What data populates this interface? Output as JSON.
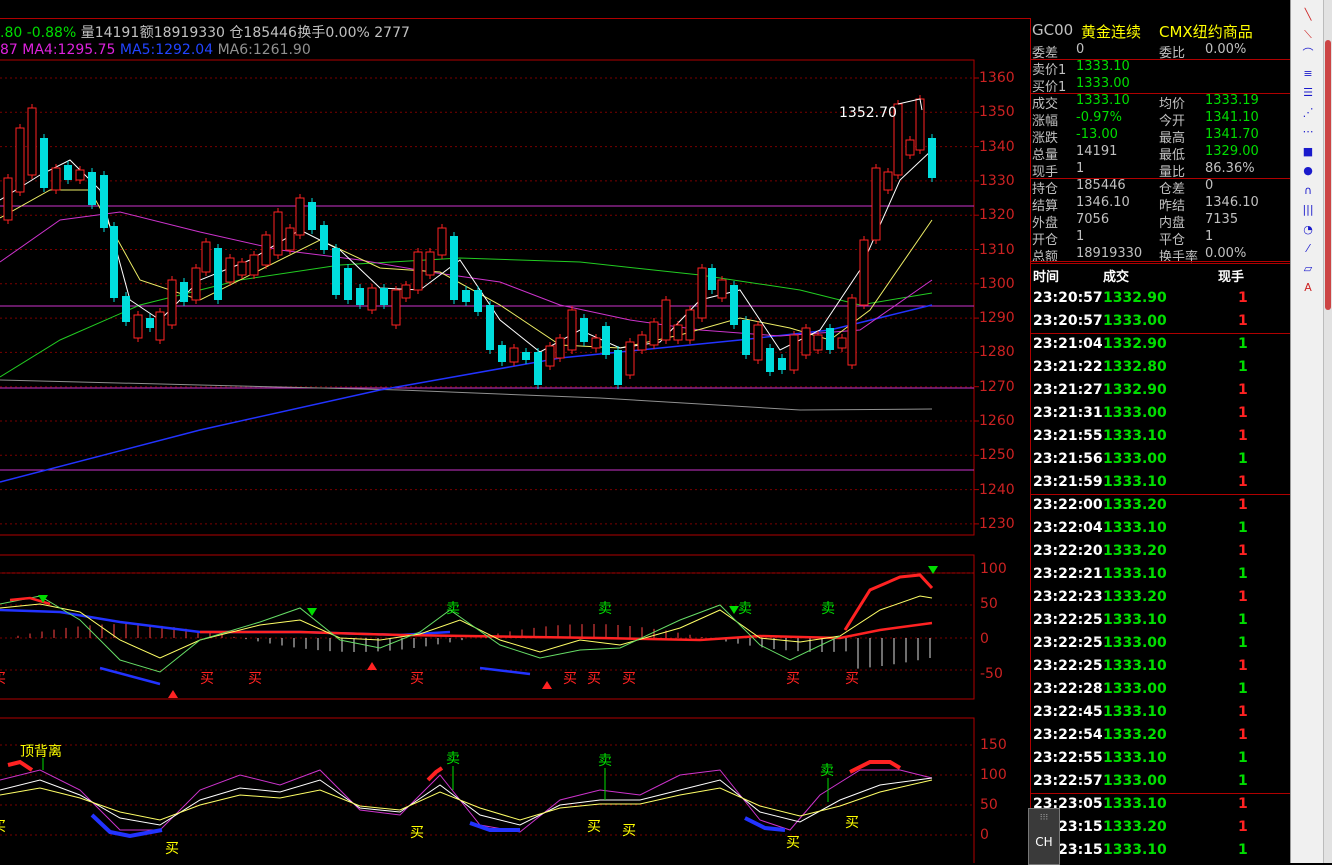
{
  "info_line1": {
    "price": ".80",
    "change_pct": "-0.88%",
    "volume": "量14191",
    "amount": "额18919330",
    "position": "仓185446",
    "turnover": "换手0.00%",
    "count": "2777"
  },
  "info_line2": {
    "ma3": "87",
    "ma4": "MA4:1295.75",
    "ma5": "MA5:1292.04",
    "ma6": "MA6:1261.90"
  },
  "price_axis": [
    "1360",
    "1350",
    "1340",
    "1330",
    "1320",
    "1310",
    "1300",
    "1290",
    "1280",
    "1270",
    "1260",
    "1250",
    "1240",
    "1230"
  ],
  "peak_label": "1352.70",
  "macd_axis": [
    "100",
    "50",
    "0",
    "-50"
  ],
  "kdj_axis": [
    "150",
    "100",
    "50",
    "0"
  ],
  "signals": {
    "sell": "卖",
    "buy": "买",
    "divergence": "顶背离"
  },
  "quote": {
    "code": "GC00",
    "name": "黄金连续",
    "market": "CMX纽约商品",
    "fields": [
      {
        "l1": "委差",
        "v1": "0",
        "l2": "委比",
        "v2": "0.00%",
        "c1": "#c0c0c0",
        "c2": "#c0c0c0"
      },
      {
        "l1": "卖价1",
        "v1": "1333.10",
        "l2": "",
        "v2": "",
        "c1": "#00dd00",
        "c2": "#c0c0c0"
      },
      {
        "l1": "买价1",
        "v1": "1333.00",
        "l2": "",
        "v2": "",
        "c1": "#00dd00",
        "c2": "#c0c0c0"
      },
      {
        "l1": "成交",
        "v1": "1333.10",
        "l2": "均价",
        "v2": "1333.19",
        "c1": "#00dd00",
        "c2": "#00dd00"
      },
      {
        "l1": "涨幅",
        "v1": "-0.97%",
        "l2": "今开",
        "v2": "1341.10",
        "c1": "#00dd00",
        "c2": "#00dd00"
      },
      {
        "l1": "涨跌",
        "v1": "-13.00",
        "l2": "最高",
        "v2": "1341.70",
        "c1": "#00dd00",
        "c2": "#00dd00"
      },
      {
        "l1": "总量",
        "v1": "14191",
        "l2": "最低",
        "v2": "1329.00",
        "c1": "#c0c0c0",
        "c2": "#00dd00"
      },
      {
        "l1": "现手",
        "v1": "1",
        "l2": "量比",
        "v2": "86.36%",
        "c1": "#c0c0c0",
        "c2": "#c0c0c0"
      },
      {
        "l1": "持仓",
        "v1": "185446",
        "l2": "仓差",
        "v2": "0",
        "c1": "#c0c0c0",
        "c2": "#c0c0c0"
      },
      {
        "l1": "结算",
        "v1": "1346.10",
        "l2": "昨结",
        "v2": "1346.10",
        "c1": "#c0c0c0",
        "c2": "#c0c0c0"
      },
      {
        "l1": "外盘",
        "v1": "7056",
        "l2": "内盘",
        "v2": "7135",
        "c1": "#c0c0c0",
        "c2": "#c0c0c0"
      },
      {
        "l1": "开仓",
        "v1": "1",
        "l2": "平仓",
        "v2": "1",
        "c1": "#c0c0c0",
        "c2": "#c0c0c0"
      },
      {
        "l1": "总额",
        "v1": "18919330",
        "l2": "换手率",
        "v2": "0.00%",
        "c1": "#c0c0c0",
        "c2": "#c0c0c0"
      }
    ],
    "ts_headers": {
      "time": "时间",
      "price": "成交",
      "vol": "现手"
    },
    "ticks": [
      {
        "t": "23:20:57",
        "p": "1332.90",
        "v": "1",
        "vc": "#ff2222"
      },
      {
        "t": "23:20:57",
        "p": "1333.00",
        "v": "1",
        "vc": "#ff2222"
      },
      {
        "t": "23:21:04",
        "p": "1332.90",
        "v": "1",
        "vc": "#00dd00"
      },
      {
        "t": "23:21:22",
        "p": "1332.80",
        "v": "1",
        "vc": "#00dd00"
      },
      {
        "t": "23:21:27",
        "p": "1332.90",
        "v": "1",
        "vc": "#ff2222"
      },
      {
        "t": "23:21:31",
        "p": "1333.00",
        "v": "1",
        "vc": "#ff2222"
      },
      {
        "t": "23:21:55",
        "p": "1333.10",
        "v": "1",
        "vc": "#ff2222"
      },
      {
        "t": "23:21:56",
        "p": "1333.00",
        "v": "1",
        "vc": "#00dd00"
      },
      {
        "t": "23:21:59",
        "p": "1333.10",
        "v": "1",
        "vc": "#ff2222"
      },
      {
        "t": "23:22:00",
        "p": "1333.20",
        "v": "1",
        "vc": "#ff2222"
      },
      {
        "t": "23:22:04",
        "p": "1333.10",
        "v": "1",
        "vc": "#00dd00"
      },
      {
        "t": "23:22:20",
        "p": "1333.20",
        "v": "1",
        "vc": "#ff2222"
      },
      {
        "t": "23:22:21",
        "p": "1333.10",
        "v": "1",
        "vc": "#00dd00"
      },
      {
        "t": "23:22:23",
        "p": "1333.20",
        "v": "1",
        "vc": "#ff2222"
      },
      {
        "t": "23:22:25",
        "p": "1333.10",
        "v": "1",
        "vc": "#00dd00"
      },
      {
        "t": "23:22:25",
        "p": "1333.00",
        "v": "1",
        "vc": "#00dd00"
      },
      {
        "t": "23:22:25",
        "p": "1333.10",
        "v": "1",
        "vc": "#ff2222"
      },
      {
        "t": "23:22:28",
        "p": "1333.00",
        "v": "1",
        "vc": "#00dd00"
      },
      {
        "t": "23:22:45",
        "p": "1333.10",
        "v": "1",
        "vc": "#ff2222"
      },
      {
        "t": "23:22:54",
        "p": "1333.20",
        "v": "1",
        "vc": "#ff2222"
      },
      {
        "t": "23:22:55",
        "p": "1333.10",
        "v": "1",
        "vc": "#00dd00"
      },
      {
        "t": "23:22:57",
        "p": "1333.00",
        "v": "1",
        "vc": "#00dd00"
      },
      {
        "t": "23:23:05",
        "p": "1333.10",
        "v": "1",
        "vc": "#ff2222"
      },
      {
        "t": "23:23:15",
        "p": "1333.20",
        "v": "1",
        "vc": "#ff2222"
      },
      {
        "t": "23:23:15",
        "p": "1333.10",
        "v": "1",
        "vc": "#00dd00"
      }
    ]
  },
  "ime_label": "CH",
  "toolbar": [
    "line-tool-icon",
    "ray-tool-icon",
    "arc-tool-icon",
    "parallel-lines-icon",
    "fibonacci-icon",
    "fan-lines-icon",
    "gann-icon",
    "rectangle-icon",
    "ellipse-icon",
    "wave-icon",
    "bars-icon",
    "cycle-icon",
    "pen-icon",
    "eraser-icon",
    "text-tool-icon"
  ],
  "colors": {
    "up": "#ff2222",
    "down": "#00dddd",
    "frame": "#b00000",
    "green": "#00dd00",
    "yellow": "#ffff00"
  }
}
